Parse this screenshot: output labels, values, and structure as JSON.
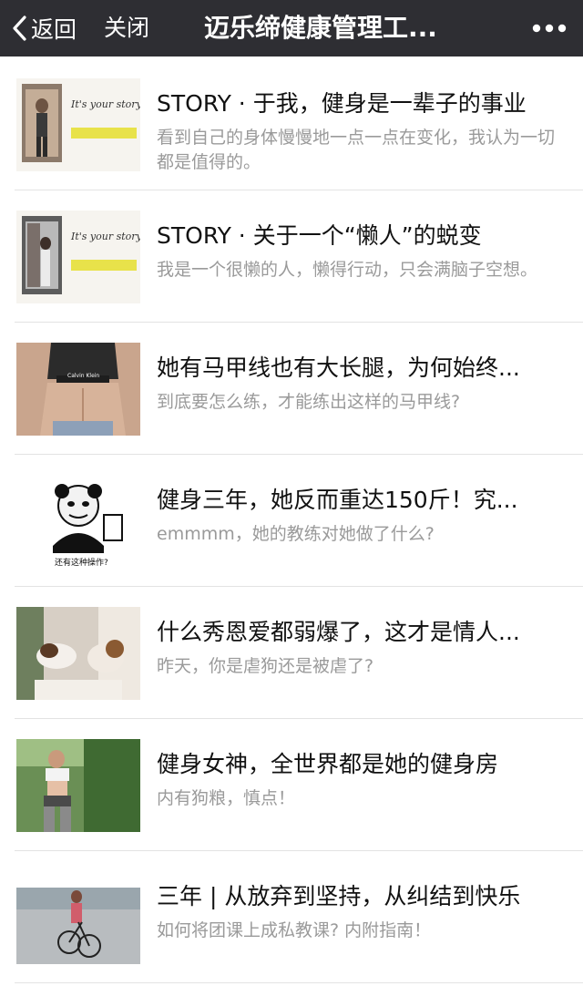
{
  "header": {
    "back_label": "返回",
    "close_label": "关闭",
    "title": "迈乐缔健康管理工...",
    "back_icon": "chevron-left-icon",
    "more_icon": "more-dots-icon"
  },
  "colors": {
    "topbar_bg": "#2e2e33",
    "title_text": "#111111",
    "desc_text": "#9a9a9a",
    "divider": "#e3e3e3"
  },
  "articles": [
    {
      "title": "STORY · 于我，健身是一辈子的事业",
      "desc": "看到自己的身体慢慢地一点一点在变化，我认为一切都是值得的。",
      "thumb_text": "It's your story."
    },
    {
      "title": "STORY · 关于一个“懒人”的蜕变",
      "desc": "我是一个很懒的人，懒得行动，只会满脑子空想。",
      "thumb_text": "It's your story."
    },
    {
      "title": "她有马甲线也有大长腿，为何始终...",
      "desc": "到底要怎么练，才能练出这样的马甲线?",
      "thumb_text": "Calvin Klein"
    },
    {
      "title": "健身三年，她反而重达150斤！究...",
      "desc": "emmmm，她的教练对她做了什么?",
      "thumb_text": "还有这种操作?"
    },
    {
      "title": "什么秀恩爱都弱爆了，这才是情人...",
      "desc": "昨天，你是虐狗还是被虐了?",
      "thumb_text": ""
    },
    {
      "title": "健身女神，全世界都是她的健身房",
      "desc": "内有狗粮，慎点！",
      "thumb_text": ""
    },
    {
      "title": "三年 | 从放弃到坚持，从纠结到快乐",
      "desc": "如何将团课上成私教课? 内附指南！",
      "thumb_text": ""
    }
  ]
}
